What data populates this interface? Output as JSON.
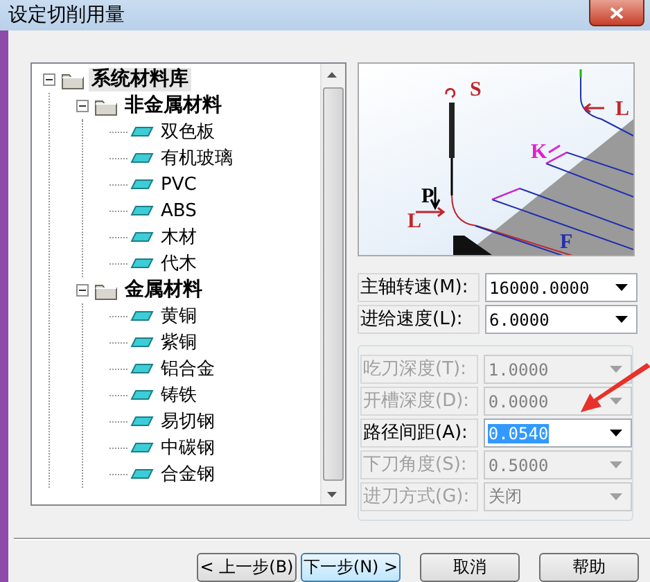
{
  "window": {
    "title": "设定切削用量"
  },
  "tree": {
    "items": [
      {
        "label": "系统材料库",
        "kind": "folder",
        "expanded": true,
        "selected": true,
        "children": [
          {
            "label": "非金属材料",
            "kind": "folder",
            "expanded": true,
            "selected": false,
            "children": [
              {
                "label": "双色板",
                "kind": "material",
                "selected": false
              },
              {
                "label": "有机玻璃",
                "kind": "material",
                "selected": false
              },
              {
                "label": "PVC",
                "kind": "material",
                "selected": false
              },
              {
                "label": "ABS",
                "kind": "material",
                "selected": false
              },
              {
                "label": "木材",
                "kind": "material",
                "selected": false
              },
              {
                "label": "代木",
                "kind": "material",
                "selected": false
              }
            ]
          },
          {
            "label": "金属材料",
            "kind": "folder",
            "expanded": true,
            "selected": false,
            "children": [
              {
                "label": "黄铜",
                "kind": "material",
                "selected": false
              },
              {
                "label": "紫铜",
                "kind": "material",
                "selected": false
              },
              {
                "label": "铝合金",
                "kind": "material",
                "selected": false
              },
              {
                "label": "铸铁",
                "kind": "material",
                "selected": false
              },
              {
                "label": "易切钢",
                "kind": "material",
                "selected": false
              },
              {
                "label": "中碳钢",
                "kind": "material",
                "selected": false
              },
              {
                "label": "合金钢",
                "kind": "material",
                "selected": false
              }
            ]
          }
        ]
      }
    ]
  },
  "diagram": {
    "labels": [
      "S",
      "P",
      "L",
      "K",
      "F",
      "L"
    ]
  },
  "speed_fields": [
    {
      "label": "主轴转速(M):",
      "value": "16000.0000",
      "disabled": false,
      "highlighted": false
    },
    {
      "label": "进给速度(L):",
      "value": "6.0000",
      "disabled": false,
      "highlighted": false
    }
  ],
  "cut_fields": [
    {
      "label": "吃刀深度(T):",
      "value": "1.0000",
      "disabled": true,
      "highlighted": false
    },
    {
      "label": "开槽深度(D):",
      "value": "0.0000",
      "disabled": true,
      "highlighted": false
    },
    {
      "label": "路径间距(A):",
      "value": "0.0540",
      "disabled": false,
      "highlighted": true
    },
    {
      "label": "下刀角度(S):",
      "value": "0.5000",
      "disabled": true,
      "highlighted": false
    },
    {
      "label": "进刀方式(G):",
      "value": "关闭",
      "disabled": true,
      "highlighted": false
    }
  ],
  "buttons": [
    {
      "label": "< 上一步(B)",
      "focused": false
    },
    {
      "label": "下一步(N) >",
      "focused": true
    },
    {
      "label": "取消",
      "focused": false
    },
    {
      "label": "帮助",
      "focused": false
    }
  ]
}
